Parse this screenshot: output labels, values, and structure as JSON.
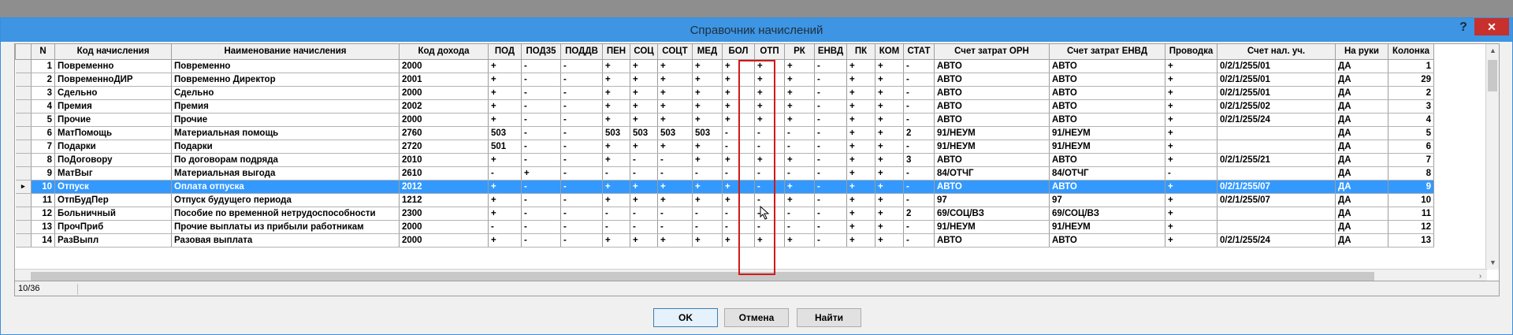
{
  "window": {
    "title": "Справочник начислений",
    "help_label": "?",
    "close_label": "✕"
  },
  "grid": {
    "columns": [
      "N",
      "Код начисления",
      "Наименование начисления",
      "Код дохода",
      "ПОД",
      "ПОД35",
      "ПОДДВ",
      "ПЕН",
      "СОЦ",
      "СОЦТ",
      "МЕД",
      "БОЛ",
      "ОТП",
      "РК",
      "ЕНВД",
      "ПК",
      "КОМ",
      "СТАТ",
      "Счет затрат ОРН",
      "Счет затрат ЕНВД",
      "Проводка",
      "Счет нал. уч.",
      "На руки",
      "Колонка"
    ],
    "selected_index": 9,
    "rows": [
      [
        "1",
        "Повременно",
        "Повременно",
        "2000",
        "+",
        "-",
        "-",
        "+",
        "+",
        "+",
        "+",
        "+",
        "+",
        "+",
        "-",
        "+",
        "+",
        "-",
        "АВТО",
        "АВТО",
        "+",
        "0/2/1/255/01",
        "ДА",
        "1"
      ],
      [
        "2",
        "ПовременноДИР",
        "Повременно Директор",
        "2001",
        "+",
        "-",
        "-",
        "+",
        "+",
        "+",
        "+",
        "+",
        "+",
        "+",
        "-",
        "+",
        "+",
        "-",
        "АВТО",
        "АВТО",
        "+",
        "0/2/1/255/01",
        "ДА",
        "29"
      ],
      [
        "3",
        "Сдельно",
        "Сдельно",
        "2000",
        "+",
        "-",
        "-",
        "+",
        "+",
        "+",
        "+",
        "+",
        "+",
        "+",
        "-",
        "+",
        "+",
        "-",
        "АВТО",
        "АВТО",
        "+",
        "0/2/1/255/01",
        "ДА",
        "2"
      ],
      [
        "4",
        "Премия",
        "Премия",
        "2002",
        "+",
        "-",
        "-",
        "+",
        "+",
        "+",
        "+",
        "+",
        "+",
        "+",
        "-",
        "+",
        "+",
        "-",
        "АВТО",
        "АВТО",
        "+",
        "0/2/1/255/02",
        "ДА",
        "3"
      ],
      [
        "5",
        "Прочие",
        "Прочие",
        "2000",
        "+",
        "-",
        "-",
        "+",
        "+",
        "+",
        "+",
        "+",
        "+",
        "+",
        "-",
        "+",
        "+",
        "-",
        "АВТО",
        "АВТО",
        "+",
        "0/2/1/255/24",
        "ДА",
        "4"
      ],
      [
        "6",
        "МатПомощь",
        "Материальная помощь",
        "2760",
        "503",
        "-",
        "-",
        "503",
        "503",
        "503",
        "503",
        "-",
        "-",
        "-",
        "-",
        "+",
        "+",
        "2",
        "91/НЕУМ",
        "91/НЕУМ",
        "+",
        "",
        "ДА",
        "5"
      ],
      [
        "7",
        "Подарки",
        "Подарки",
        "2720",
        "501",
        "-",
        "-",
        "+",
        "+",
        "+",
        "+",
        "-",
        "-",
        "-",
        "-",
        "+",
        "+",
        "-",
        "91/НЕУМ",
        "91/НЕУМ",
        "+",
        "",
        "ДА",
        "6"
      ],
      [
        "8",
        "ПоДоговору",
        "По договорам подряда",
        "2010",
        "+",
        "-",
        "-",
        "+",
        "-",
        "-",
        "+",
        "+",
        "+",
        "+",
        "-",
        "+",
        "+",
        "3",
        "АВТО",
        "АВТО",
        "+",
        "0/2/1/255/21",
        "ДА",
        "7"
      ],
      [
        "9",
        "МатВыг",
        "Материальная выгода",
        "2610",
        "-",
        "+",
        "-",
        "-",
        "-",
        "-",
        "-",
        "-",
        "-",
        "-",
        "-",
        "+",
        "+",
        "-",
        "84/ОТЧГ",
        "84/ОТЧГ",
        "-",
        "",
        "ДА",
        "8"
      ],
      [
        "10",
        "Отпуск",
        "Оплата отпуска",
        "2012",
        "+",
        "-",
        "-",
        "+",
        "+",
        "+",
        "+",
        "+",
        "-",
        "+",
        "-",
        "+",
        "+",
        "-",
        "АВТО",
        "АВТО",
        "+",
        "0/2/1/255/07",
        "ДА",
        "9"
      ],
      [
        "11",
        "ОтпБудПер",
        "Отпуск будущего периода",
        "1212",
        "+",
        "-",
        "-",
        "+",
        "+",
        "+",
        "+",
        "+",
        "-",
        "+",
        "-",
        "+",
        "+",
        "-",
        "97",
        "97",
        "+",
        "0/2/1/255/07",
        "ДА",
        "10"
      ],
      [
        "12",
        "Больничный",
        "Пособие по временной нетрудоспособности",
        "2300",
        "+",
        "-",
        "-",
        "-",
        "-",
        "-",
        "-",
        "-",
        "-",
        "-",
        "-",
        "+",
        "+",
        "2",
        "69/СОЦ/ВЗ",
        "69/СОЦ/ВЗ",
        "+",
        "",
        "ДА",
        "11"
      ],
      [
        "13",
        "ПрочПриб",
        "Прочие выплаты из прибыли работникам",
        "2000",
        "-",
        "-",
        "-",
        "-",
        "-",
        "-",
        "-",
        "-",
        "-",
        "-",
        "-",
        "+",
        "+",
        "-",
        "91/НЕУМ",
        "91/НЕУМ",
        "+",
        "",
        "ДА",
        "12"
      ],
      [
        "14",
        "РазВыпл",
        "Разовая выплата",
        "2000",
        "+",
        "-",
        "-",
        "+",
        "+",
        "+",
        "+",
        "+",
        "+",
        "+",
        "-",
        "+",
        "+",
        "-",
        "АВТО",
        "АВТО",
        "+",
        "0/2/1/255/24",
        "ДА",
        "13"
      ]
    ]
  },
  "status": {
    "position": "10/36"
  },
  "buttons": {
    "ok": "OK",
    "cancel": "Отмена",
    "find": "Найти"
  }
}
